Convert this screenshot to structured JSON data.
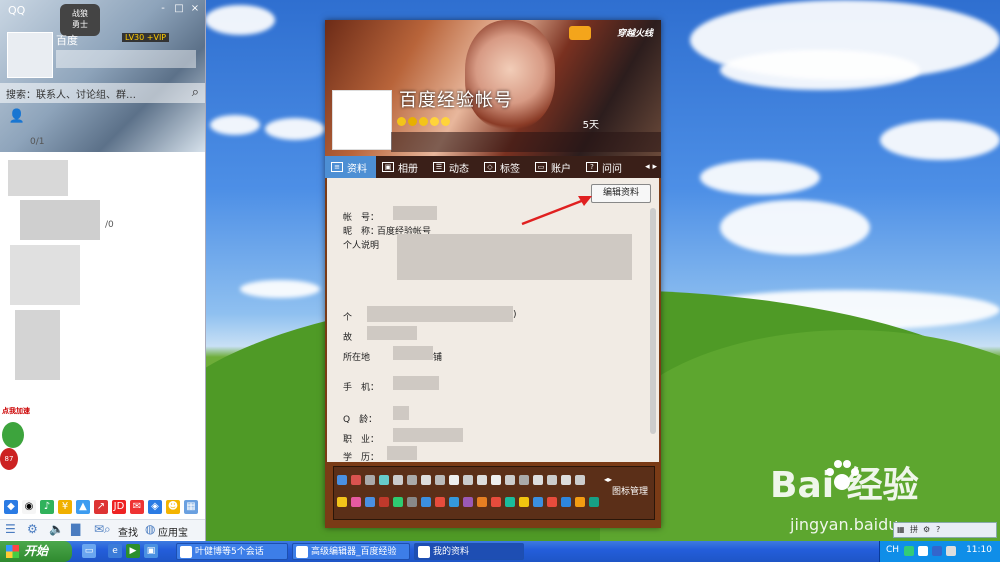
{
  "qq": {
    "title": "QQ",
    "window_controls": [
      "-",
      "□",
      "×"
    ],
    "badge_text": "战狼\n勇士",
    "nickname": "百度",
    "level": "LV30 +VIP",
    "search_placeholder": "搜索：联系人、讨论组、群…",
    "group_count": "0/1",
    "side_count": "/0",
    "ad_title": "点我加速",
    "ad_number": "87",
    "find_label": "查找",
    "appstore_label": "应用宝"
  },
  "profile": {
    "display_name": "百度经验帐号",
    "cover_logo": "穿越火线",
    "cover_fans": "5天",
    "tabs": [
      {
        "label": "资料",
        "icon": "id-card-icon",
        "active": true
      },
      {
        "label": "相册",
        "icon": "photo-icon",
        "active": false
      },
      {
        "label": "动态",
        "icon": "feed-icon",
        "active": false
      },
      {
        "label": "标签",
        "icon": "tag-icon",
        "active": false
      },
      {
        "label": "账户",
        "icon": "wallet-icon",
        "active": false
      },
      {
        "label": "问问",
        "icon": "question-icon",
        "active": false
      }
    ],
    "edit_button": "编辑资料",
    "fields": {
      "account_label": "帐　号：",
      "nickname_label": "昵　称：",
      "nickname_value": "百度经验帐号",
      "bio_label": "个人说明",
      "personal_label": "个",
      "personal_tail": ")",
      "hometown_label": "故",
      "location_label": "所在地",
      "location_tail": "铺",
      "phone_label": "手　机：",
      "age_label": "Q　龄：",
      "job_label": "职　业：",
      "edu_label": "学　历："
    },
    "icon_manage": "图标管理",
    "accent": "#4d8fd4",
    "frame_color": "#7a3b16"
  },
  "watermark": {
    "brand": "Bai  经验",
    "url": "jingyan.baidu"
  },
  "taskbar": {
    "start": "开始",
    "tasks": [
      {
        "label": "叶健博等5个会话",
        "active": false
      },
      {
        "label": "高级编辑器_百度经验",
        "active": false
      },
      {
        "label": "我的资料",
        "active": true
      }
    ],
    "lang": "CH",
    "clock": "11:10"
  }
}
